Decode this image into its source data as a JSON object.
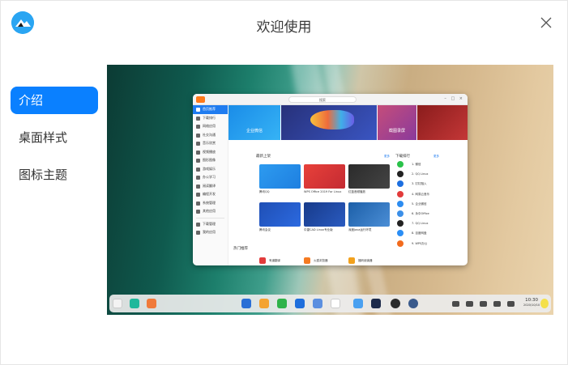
{
  "window": {
    "title": "欢迎使用"
  },
  "nav": {
    "items": [
      {
        "label": "介绍",
        "active": true
      },
      {
        "label": "桌面样式",
        "active": false
      },
      {
        "label": "图标主题",
        "active": false
      }
    ]
  },
  "preview": {
    "store": {
      "search_placeholder": "搜索",
      "sidebar": [
        "首页推荐",
        "下载排行",
        "网络应用",
        "社交沟通",
        "音乐欣赏",
        "视频播放",
        "图形图像",
        "游戏娱乐",
        "办公学习",
        "阅读翻译",
        "编程开发",
        "系统管理",
        "其他应用"
      ],
      "sidebar_bottom": [
        "下载管理",
        "我的应用"
      ],
      "banners": [
        "企业微信",
        "截图录屏"
      ],
      "sections": {
        "new": "最新上架",
        "rank": "下载排行",
        "hot": "热门推荐",
        "more": "更多"
      },
      "new_apps": [
        "腾讯QQ",
        "WPS Office 2019 For Linux",
        "红蓝音频播放",
        "腾讯会议",
        "中望CAD Linux专业版",
        "深度Java运行环境"
      ],
      "ranking": [
        "1.  微信",
        "2.  QQ Linux",
        "3.  钉钉融入",
        "4.  网易云音乐",
        "5.  企业微信",
        "6.  永中Office",
        "7.  QQ Linux",
        "8.  百度网盘",
        "9.  WPS办公"
      ],
      "hot": [
        "有道翻译",
        "火狐浏览器",
        "福昕阅读器"
      ]
    },
    "taskbar": {
      "time": "10:30",
      "date": "2020/10/10"
    }
  }
}
